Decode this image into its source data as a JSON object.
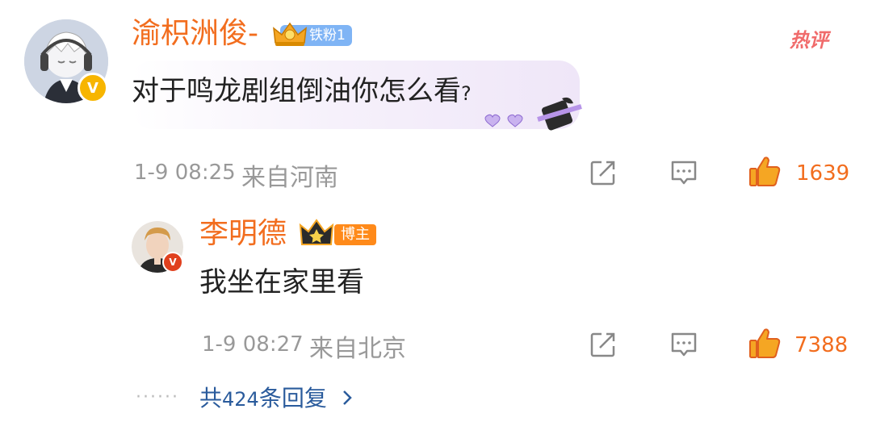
{
  "main_comment": {
    "username": "渝枳洲俊-",
    "badge_label": "铁粉1",
    "hot_label": "热评",
    "text": "对于鸣龙剧组倒油你怎么看",
    "text_suffix": "?",
    "time": "1-9 08:25",
    "location": "来自河南",
    "likes": "1639"
  },
  "reply": {
    "username": "李明德",
    "badge_label": "博主",
    "text": "我坐在家里看",
    "time": "1-9 08:27",
    "location": "来自北京",
    "likes": "7388"
  },
  "more_replies": {
    "label_prefix": "共",
    "count": "424",
    "label_suffix": "条回复"
  },
  "colors": {
    "username": "#f26d1e",
    "like": "#f26d1e",
    "link": "#2a5b9c",
    "meta": "#999999",
    "verified": "#f7b500"
  },
  "icons": [
    "verified-icon",
    "crown-icon",
    "share-icon",
    "comment-icon",
    "like-icon",
    "chevron-right-icon"
  ]
}
